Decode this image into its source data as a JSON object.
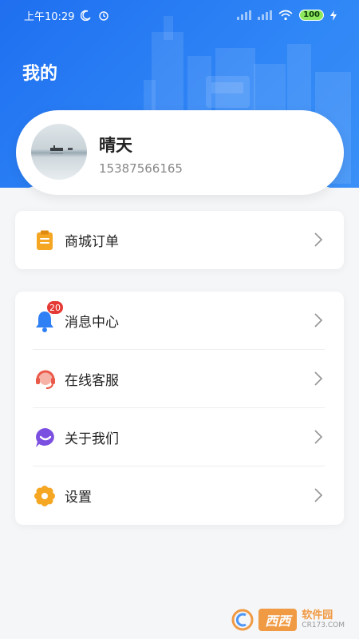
{
  "status_bar": {
    "time": "上午10:29",
    "battery": "100"
  },
  "header": {
    "title": "我的"
  },
  "profile": {
    "name": "晴天",
    "phone": "15387566165"
  },
  "menu_group_1": [
    {
      "label": "商城订单",
      "icon": "clipboard-icon"
    }
  ],
  "menu_group_2": [
    {
      "label": "消息中心",
      "icon": "bell-icon",
      "badge": "20"
    },
    {
      "label": "在线客服",
      "icon": "headset-icon"
    },
    {
      "label": "关于我们",
      "icon": "chat-smile-icon"
    },
    {
      "label": "设置",
      "icon": "gear-flower-icon"
    }
  ],
  "watermark": {
    "logo": "西西",
    "text": "软件园",
    "sub": "CR173.COM"
  },
  "colors": {
    "header_blue": "#1f6ff0",
    "badge_red": "#e53935",
    "orange": "#f5a623",
    "purple": "#7b4fe0"
  }
}
